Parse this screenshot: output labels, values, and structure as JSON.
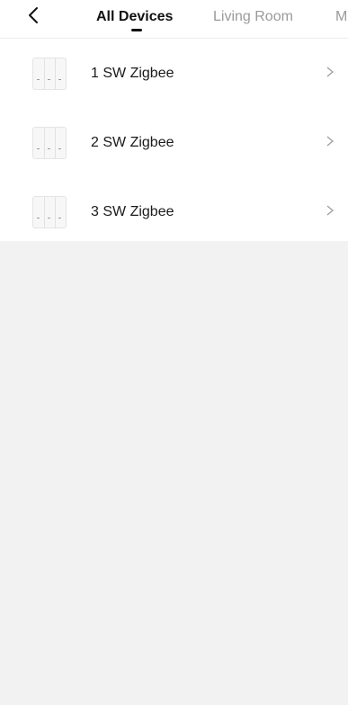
{
  "header": {
    "tabs": [
      {
        "label": "All Devices",
        "active": true
      },
      {
        "label": "Living Room",
        "active": false
      },
      {
        "label": "M",
        "active": false
      }
    ]
  },
  "devices": [
    {
      "name": "1 SW Zigbee",
      "icon": "wall-switch-icon"
    },
    {
      "name": "2 SW Zigbee",
      "icon": "wall-switch-icon"
    },
    {
      "name": "3 SW Zigbee",
      "icon": "wall-switch-icon"
    }
  ],
  "colors": {
    "background": "#f2f2f2",
    "surface": "#ffffff",
    "active_tab": "#111111",
    "inactive_tab": "#9a9a9a"
  }
}
